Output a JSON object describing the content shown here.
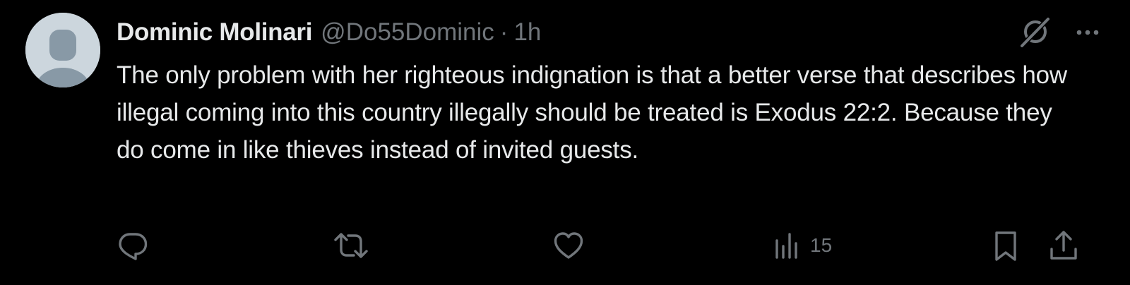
{
  "tweet": {
    "author_name": "Dominic Molinari",
    "handle": "@Do55Dominic",
    "separator": "·",
    "time": "1h",
    "text": "The only problem with her righteous indignation is that a better verse that describes how illegal coming into this country illegally should be treated is Exodus 22:2. Because they do come in like thieves instead of invited guests.",
    "avatar_icon": "default-avatar-silhouette",
    "top_icons": [
      "grok-icon",
      "more-icon"
    ]
  },
  "actions": {
    "reply_icon": "reply-icon",
    "repost_icon": "repost-icon",
    "like_icon": "like-icon",
    "views_icon": "views-icon",
    "views_count": "15",
    "bookmark_icon": "bookmark-icon",
    "share_icon": "share-icon"
  },
  "colors": {
    "background": "#000000",
    "primary_text": "#e7e9ea",
    "secondary_text": "#71767b",
    "avatar_bg": "#ccd6dd",
    "avatar_fg": "#8899a6"
  }
}
